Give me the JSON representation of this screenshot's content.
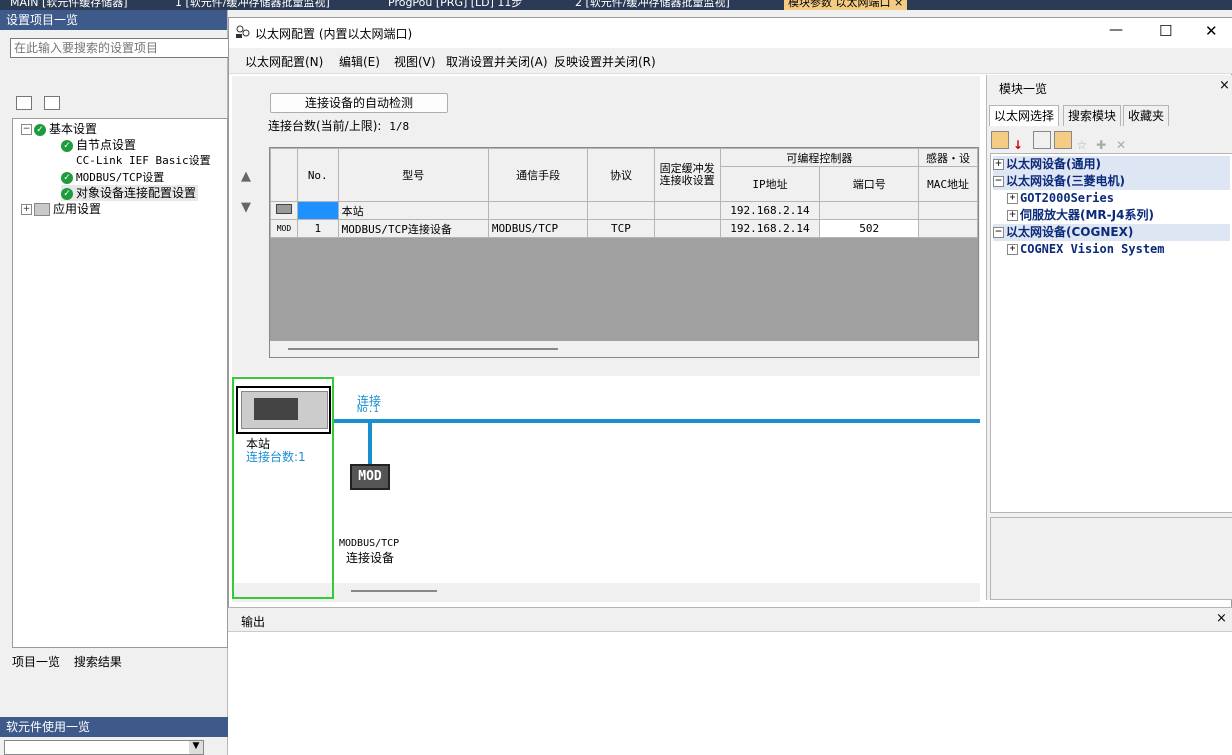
{
  "top_tabs": [
    {
      "label": "MAIN [软元件缓存储器]"
    },
    {
      "label": "1 [软元件/缓冲存储器批量监视]"
    },
    {
      "label": "ProgPou [PRG] [LD] 11步"
    },
    {
      "label": "2 [软元件/缓冲存储器批量监视]"
    },
    {
      "label": "模块参数 以太网端口"
    }
  ],
  "top_tab_close": "×",
  "left_panel": {
    "title": "设置项目一览",
    "search_placeholder": "在此输入要搜索的设置项目",
    "tree": [
      {
        "label": "基本设置",
        "toggle": "⊟"
      },
      {
        "label": "自节点设置"
      },
      {
        "label": "CC-Link IEF Basic设置"
      },
      {
        "label": "MODBUS/TCP设置"
      },
      {
        "label": "对象设备连接配置设置"
      },
      {
        "label": "应用设置",
        "toggle": "⊞"
      }
    ],
    "bottom_tabs": [
      "项目一览",
      "搜索结果"
    ],
    "softdev_title": "软元件使用一览"
  },
  "window": {
    "title": "以太网配置 (内置以太网端口)",
    "controls": {
      "minimize": "—",
      "maximize": "☐",
      "close": "✕"
    },
    "menu": [
      "以太网配置(N)",
      "编辑(E)",
      "视图(V)",
      "取消设置并关闭(A)",
      "反映设置并关闭(R)"
    ]
  },
  "config": {
    "autodetect_label": "连接设备的自动检测",
    "count_label": "连接台数(当前/上限):",
    "count_value": "1/8",
    "nav_up": "▲",
    "nav_down": "▼",
    "table": {
      "headers": {
        "no": "No.",
        "model": "型号",
        "comm": "通信手段",
        "protocol": "协议",
        "fixed_buffer": "固定缓冲发\n连接收设置",
        "plc_group": "可编程控制器",
        "ip": "IP地址",
        "port": "端口号",
        "sensor_group": "感器・设",
        "mac": "MAC地址"
      },
      "rows": [
        {
          "icon": "",
          "no": "",
          "model": "本站",
          "comm": "",
          "protocol": "",
          "fixed": "",
          "ip": "192.168.2.14",
          "port": "",
          "mac": ""
        },
        {
          "icon": "MOD",
          "no": "1",
          "model": "MODBUS/TCP连接设备",
          "comm": "MODBUS/TCP",
          "protocol": "TCP",
          "fixed": "",
          "ip": "192.168.2.14",
          "port": "502",
          "mac": ""
        }
      ]
    },
    "diagram": {
      "station_label": "本站",
      "station_count": "连接台数:1",
      "link_label": "连接",
      "link_no": "No.1",
      "device_badge": "MOD",
      "device_label_1": "MODBUS/TCP",
      "device_label_2": "连接设备"
    }
  },
  "right_panel": {
    "title": "模块一览",
    "tabs": [
      "以太网选择",
      "搜索模块",
      "收藏夹"
    ],
    "tree": [
      {
        "label": "以太网设备(通用)",
        "toggle": "⊞"
      },
      {
        "label": "以太网设备(三菱电机)",
        "toggle": "⊟"
      },
      {
        "label": "GOT2000Series",
        "toggle": "⊞"
      },
      {
        "label": "伺服放大器(MR-J4系列)",
        "toggle": "⊞"
      },
      {
        "label": "以太网设备(COGNEX)",
        "toggle": "⊟"
      },
      {
        "label": "COGNEX Vision System",
        "toggle": "⊞"
      }
    ]
  },
  "output": {
    "title": "输出"
  },
  "colors": {
    "accent": "#3d5a8a",
    "link": "#1a8fd0",
    "station_border": "#33cc33",
    "selected_cell": "#1e90ff"
  }
}
